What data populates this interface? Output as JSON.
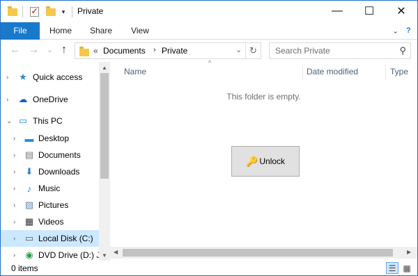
{
  "window": {
    "title": "Private",
    "accent": "#1979ca",
    "controls": {
      "minimize": "—",
      "maximize": "☐",
      "close": "✕"
    }
  },
  "quick_access_toolbar": {
    "icons": [
      "folder-icon",
      "properties-icon",
      "new-folder-icon",
      "customize-dropdown-icon"
    ],
    "dropdown_glyph": "▾"
  },
  "ribbon": {
    "tabs": [
      {
        "label": "File",
        "active": true
      },
      {
        "label": "Home"
      },
      {
        "label": "Share"
      },
      {
        "label": "View"
      }
    ],
    "expand_glyph": "⌄",
    "help_glyph": "?"
  },
  "address_bar": {
    "overflow_glyph": "«",
    "breadcrumbs": [
      "Documents",
      "Private"
    ],
    "separator_glyph": "›",
    "dropdown_glyph": "⌄",
    "refresh_glyph": "↻"
  },
  "nav_buttons": {
    "back": "←",
    "forward": "→",
    "recent": "⌄",
    "up": "↑"
  },
  "search": {
    "placeholder": "Search Private",
    "value": "",
    "icon_glyph": "⚲"
  },
  "nav_pane": {
    "items": [
      {
        "label": "Quick access",
        "icon": "star-icon",
        "glyph": "★",
        "color": "#2a8ad4",
        "expander": "›",
        "level": 0
      },
      {
        "label": "OneDrive",
        "icon": "cloud-icon",
        "glyph": "☁",
        "color": "#0a64c2",
        "expander": "›",
        "level": 0
      },
      {
        "label": "This PC",
        "icon": "computer-icon",
        "glyph": "▭",
        "color": "#2a8ad4",
        "expander": "⌄",
        "level": 0
      },
      {
        "label": "Desktop",
        "icon": "desktop-icon",
        "glyph": "▬",
        "color": "#1e90e0",
        "expander": "›",
        "level": 1
      },
      {
        "label": "Documents",
        "icon": "documents-icon",
        "glyph": "▤",
        "color": "#7a7a7a",
        "expander": "›",
        "level": 1
      },
      {
        "label": "Downloads",
        "icon": "downloads-icon",
        "glyph": "⬇",
        "color": "#2a7fd4",
        "expander": "›",
        "level": 1
      },
      {
        "label": "Music",
        "icon": "music-icon",
        "glyph": "♪",
        "color": "#2a7fd4",
        "expander": "›",
        "level": 1
      },
      {
        "label": "Pictures",
        "icon": "pictures-icon",
        "glyph": "▨",
        "color": "#5a8fb8",
        "expander": "›",
        "level": 1
      },
      {
        "label": "Videos",
        "icon": "videos-icon",
        "glyph": "▦",
        "color": "#333333",
        "expander": "›",
        "level": 1
      },
      {
        "label": "Local Disk (C:)",
        "icon": "local-disk-icon",
        "glyph": "▭",
        "color": "#555555",
        "expander": "›",
        "level": 1,
        "selected": true
      },
      {
        "label": "DVD Drive (D:) J_",
        "icon": "dvd-drive-icon",
        "glyph": "◉",
        "color": "#2e9a4a",
        "expander": "›",
        "level": 1
      }
    ]
  },
  "columns": [
    {
      "label": "Name"
    },
    {
      "label": "Date modified"
    },
    {
      "label": "Type"
    }
  ],
  "sort_glyph": "^",
  "content": {
    "empty_message": "This folder is empty.",
    "unlock_button": {
      "label": "Unlock",
      "icon": "key-icon",
      "glyph": "🔑"
    }
  },
  "status_bar": {
    "item_count": "0 items",
    "views": [
      {
        "name": "details-view",
        "glyph": "☰",
        "active": true
      },
      {
        "name": "large-icons-view",
        "glyph": "▦",
        "active": false
      }
    ]
  }
}
